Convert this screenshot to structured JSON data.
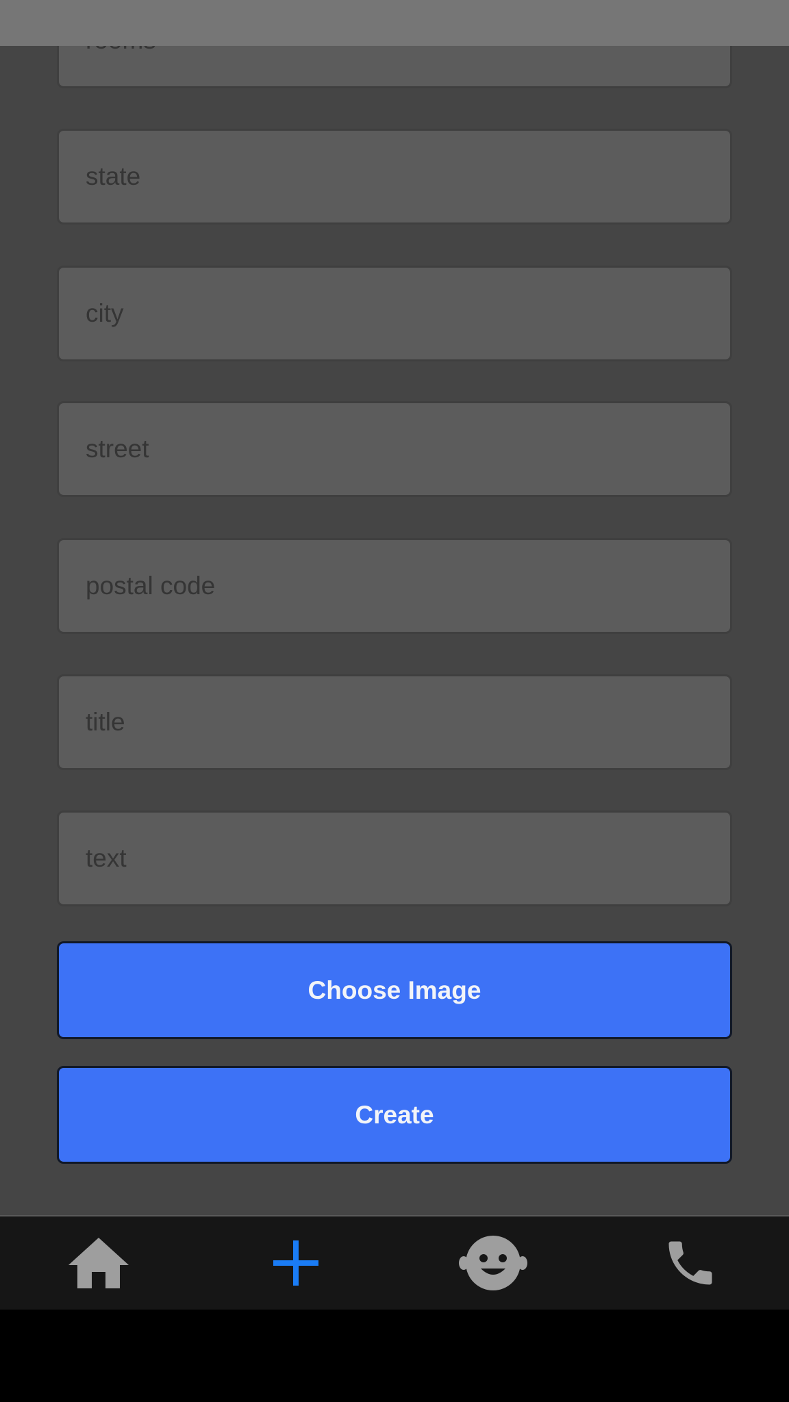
{
  "top_bar": {
    "color": "#767676"
  },
  "form": {
    "fields": [
      {
        "placeholder": "rooms"
      },
      {
        "placeholder": "state"
      },
      {
        "placeholder": "city"
      },
      {
        "placeholder": "street"
      },
      {
        "placeholder": "postal code"
      },
      {
        "placeholder": "title"
      },
      {
        "placeholder": "text"
      }
    ],
    "choose_image_label": "Choose Image",
    "create_label": "Create"
  },
  "bottom_nav": {
    "items": [
      {
        "icon": "home-icon",
        "active": false
      },
      {
        "icon": "plus-icon",
        "active": true
      },
      {
        "icon": "face-icon",
        "active": false
      },
      {
        "icon": "phone-icon",
        "active": false
      }
    ]
  },
  "colors": {
    "background": "#454545",
    "field_background": "#5c5c5c",
    "button_accent": "#3d72f6",
    "nav_active": "#1a7cf5",
    "nav_inactive": "#9e9e9e",
    "nav_background": "#161616"
  }
}
